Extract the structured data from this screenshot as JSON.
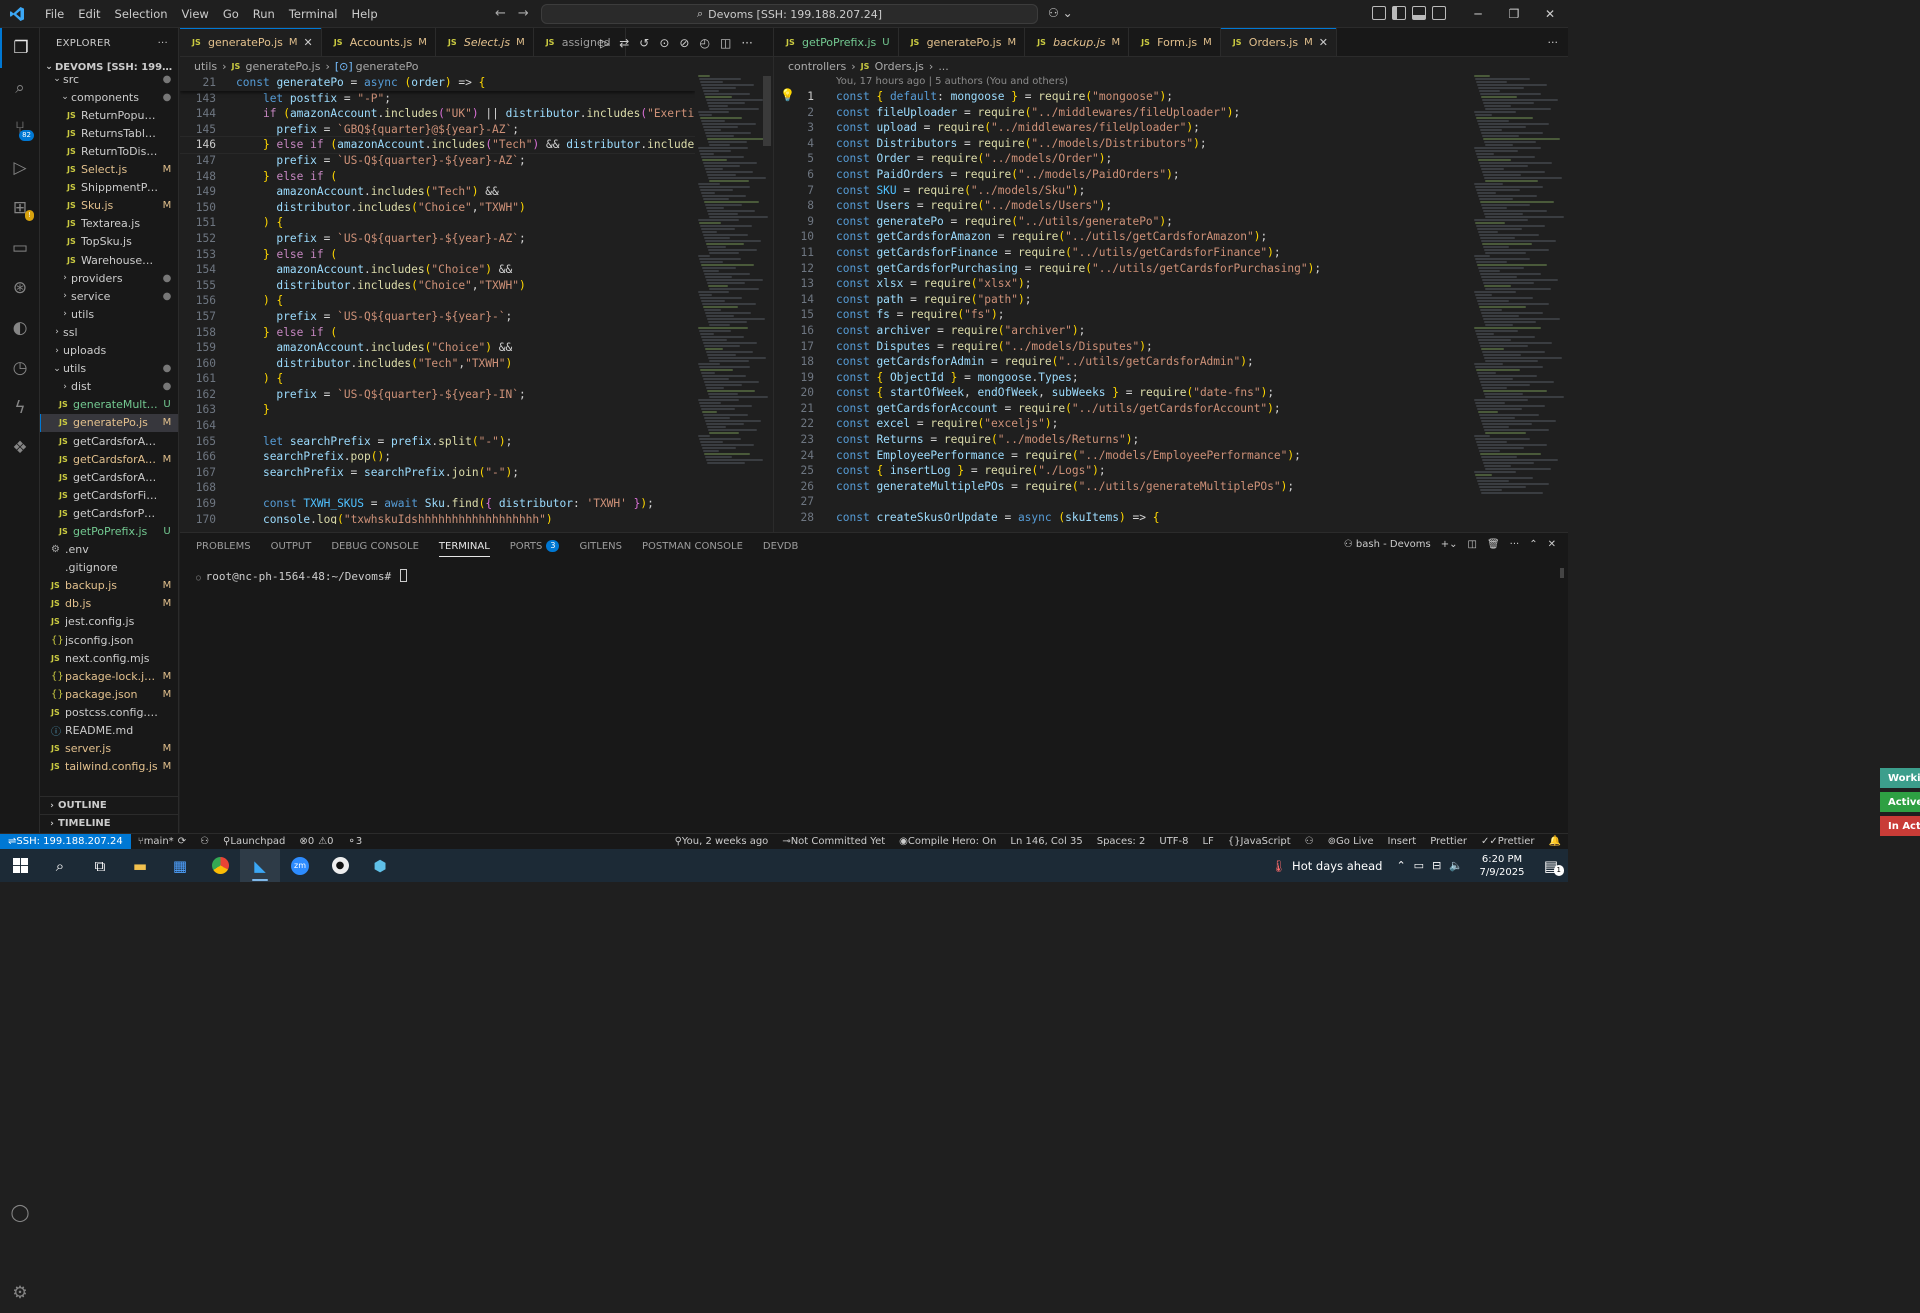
{
  "titlebar": {
    "menu": [
      "File",
      "Edit",
      "Selection",
      "View",
      "Go",
      "Run",
      "Terminal",
      "Help"
    ],
    "command_center": "Devoms [SSH: 199.188.207.24]"
  },
  "explorer": {
    "title": "EXPLORER",
    "root": "DEVOMS [SSH: 199.188.20...",
    "items": [
      {
        "label": "src",
        "type": "folder-open",
        "indent": 1,
        "status": "dot"
      },
      {
        "label": "components",
        "type": "folder-open",
        "indent": 2,
        "status": "dot"
      },
      {
        "label": "ReturnPopup.js",
        "type": "js",
        "indent": 3,
        "status": ""
      },
      {
        "label": "ReturnsTable.js",
        "type": "js",
        "indent": 3,
        "status": ""
      },
      {
        "label": "ReturnToDisti.js",
        "type": "js",
        "indent": 3,
        "status": ""
      },
      {
        "label": "Select.js",
        "type": "js",
        "indent": 3,
        "status": "M"
      },
      {
        "label": "ShippmentPending...",
        "type": "js",
        "indent": 3,
        "status": ""
      },
      {
        "label": "Sku.js",
        "type": "js",
        "indent": 3,
        "status": "M"
      },
      {
        "label": "Textarea.js",
        "type": "js",
        "indent": 3,
        "status": ""
      },
      {
        "label": "TopSku.js",
        "type": "js",
        "indent": 3,
        "status": ""
      },
      {
        "label": "WarehouseReturn.js",
        "type": "js",
        "indent": 3,
        "status": ""
      },
      {
        "label": "providers",
        "type": "folder",
        "indent": 2,
        "status": "dot"
      },
      {
        "label": "service",
        "type": "folder",
        "indent": 2,
        "status": "dot"
      },
      {
        "label": "utils",
        "type": "folder",
        "indent": 2,
        "status": ""
      },
      {
        "label": "ssl",
        "type": "folder",
        "indent": 1,
        "status": ""
      },
      {
        "label": "uploads",
        "type": "folder",
        "indent": 1,
        "status": ""
      },
      {
        "label": "utils",
        "type": "folder-open",
        "indent": 1,
        "status": "dot"
      },
      {
        "label": "dist",
        "type": "folder",
        "indent": 2,
        "status": "dot"
      },
      {
        "label": "generateMulti...",
        "type": "js",
        "indent": 2,
        "status": "U"
      },
      {
        "label": "generatePo.js",
        "type": "js",
        "indent": 2,
        "status": "M",
        "selected": true
      },
      {
        "label": "getCardsforAccount.js",
        "type": "js",
        "indent": 2,
        "status": ""
      },
      {
        "label": "getCardsforAd...",
        "type": "js",
        "indent": 2,
        "status": "M"
      },
      {
        "label": "getCardsforAmazon.js",
        "type": "js",
        "indent": 2,
        "status": ""
      },
      {
        "label": "getCardsforFinance.js",
        "type": "js",
        "indent": 2,
        "status": ""
      },
      {
        "label": "getCardsforPurchasi...",
        "type": "js",
        "indent": 2,
        "status": ""
      },
      {
        "label": "getPoPrefix.js",
        "type": "js",
        "indent": 2,
        "status": "U"
      },
      {
        "label": ".env",
        "type": "gear",
        "indent": 1,
        "status": ""
      },
      {
        "label": ".gitignore",
        "type": "plain",
        "indent": 1,
        "status": ""
      },
      {
        "label": "backup.js",
        "type": "js",
        "indent": 1,
        "status": "M"
      },
      {
        "label": "db.js",
        "type": "js",
        "indent": 1,
        "status": "M"
      },
      {
        "label": "jest.config.js",
        "type": "js",
        "indent": 1,
        "status": ""
      },
      {
        "label": "jsconfig.json",
        "type": "json",
        "indent": 1,
        "status": ""
      },
      {
        "label": "next.config.mjs",
        "type": "js",
        "indent": 1,
        "status": ""
      },
      {
        "label": "package-lock.json",
        "type": "json",
        "indent": 1,
        "status": "M"
      },
      {
        "label": "package.json",
        "type": "json",
        "indent": 1,
        "status": "M"
      },
      {
        "label": "postcss.config.mjs",
        "type": "js",
        "indent": 1,
        "status": ""
      },
      {
        "label": "README.md",
        "type": "info",
        "indent": 1,
        "status": ""
      },
      {
        "label": "server.js",
        "type": "js",
        "indent": 1,
        "status": "M"
      },
      {
        "label": "tailwind.config.js",
        "type": "js",
        "indent": 1,
        "status": "M"
      }
    ],
    "outline": "OUTLINE",
    "timeline": "TIMELINE"
  },
  "left_editor": {
    "tabs": [
      {
        "label": "generatePo.js",
        "status": "M",
        "active": true,
        "closable": true
      },
      {
        "label": "Accounts.js",
        "status": "M"
      },
      {
        "label": "Select.js",
        "status": "M",
        "italic": true
      },
      {
        "label": "assigned",
        "status": ""
      }
    ],
    "breadcrumbs": [
      "utils",
      "generatePo.js",
      "generatePo"
    ],
    "sticky_line": {
      "num": "21",
      "code": "const generatePo = async (order) => {"
    },
    "lines": [
      {
        "num": "143",
        "code": "    let postfix = \"-P\";"
      },
      {
        "num": "144",
        "code": "    if (amazonAccount.includes(\"UK\") || distributor.includes(\"Exertis\")) {"
      },
      {
        "num": "145",
        "code": "      prefix = `GBQ${quarter}@${year}-AZ`;"
      },
      {
        "num": "146",
        "code": "    } else if (amazonAccount.includes(\"Tech\") && distributor.includes(\"Tec"
      },
      {
        "num": "147",
        "code": "      prefix = `US-Q${quarter}-${year}-AZ`;"
      },
      {
        "num": "148",
        "code": "    } else if ("
      },
      {
        "num": "149",
        "code": "      amazonAccount.includes(\"Tech\") &&"
      },
      {
        "num": "150",
        "code": "      distributor.includes(\"Choice\",\"TXWH\")"
      },
      {
        "num": "151",
        "code": "    ) {"
      },
      {
        "num": "152",
        "code": "      prefix = `US-Q${quarter}-${year}-AZ`;"
      },
      {
        "num": "153",
        "code": "    } else if ("
      },
      {
        "num": "154",
        "code": "      amazonAccount.includes(\"Choice\") &&"
      },
      {
        "num": "155",
        "code": "      distributor.includes(\"Choice\",\"TXWH\")"
      },
      {
        "num": "156",
        "code": "    ) {"
      },
      {
        "num": "157",
        "code": "      prefix = `US-Q${quarter}-${year}-`;"
      },
      {
        "num": "158",
        "code": "    } else if ("
      },
      {
        "num": "159",
        "code": "      amazonAccount.includes(\"Choice\") &&"
      },
      {
        "num": "160",
        "code": "      distributor.includes(\"Tech\",\"TXWH\")"
      },
      {
        "num": "161",
        "code": "    ) {"
      },
      {
        "num": "162",
        "code": "      prefix = `US-Q${quarter}-${year}-IN`;"
      },
      {
        "num": "163",
        "code": "    }"
      },
      {
        "num": "164",
        "code": ""
      },
      {
        "num": "165",
        "code": "    let searchPrefix = prefix.split(\"-\");"
      },
      {
        "num": "166",
        "code": "    searchPrefix.pop();"
      },
      {
        "num": "167",
        "code": "    searchPrefix = searchPrefix.join(\"-\");"
      },
      {
        "num": "168",
        "code": ""
      },
      {
        "num": "169",
        "code": "    const TXWH_SKUS = await Sku.find({ distributor: 'TXWH' });"
      },
      {
        "num": "170",
        "code": "    console.log(\"txwhskuIdshhhhhhhhhhhhhhhhhh\")"
      }
    ],
    "current_line": "146"
  },
  "right_editor": {
    "tabs": [
      {
        "label": "getPoPrefix.js",
        "status": "U"
      },
      {
        "label": "generatePo.js",
        "status": "M"
      },
      {
        "label": "backup.js",
        "status": "M",
        "italic": true
      },
      {
        "label": "Form.js",
        "status": "M"
      },
      {
        "label": "Orders.js",
        "status": "M",
        "active": true,
        "closable": true
      }
    ],
    "breadcrumbs": [
      "controllers",
      "Orders.js",
      "..."
    ],
    "blame": "You, 17 hours ago | 5 authors (You and others)",
    "lines": [
      {
        "num": "1",
        "code": "const { default: mongoose } = require(\"mongoose\");"
      },
      {
        "num": "2",
        "code": "const fileUploader = require(\"../middlewares/fileUploader\");"
      },
      {
        "num": "3",
        "code": "const upload = require(\"../middlewares/fileUploader\");"
      },
      {
        "num": "4",
        "code": "const Distributors = require(\"../models/Distributors\");"
      },
      {
        "num": "5",
        "code": "const Order = require(\"../models/Order\");"
      },
      {
        "num": "6",
        "code": "const PaidOrders = require(\"../models/PaidOrders\");"
      },
      {
        "num": "7",
        "code": "const SKU = require(\"../models/Sku\");"
      },
      {
        "num": "8",
        "code": "const Users = require(\"../models/Users\");"
      },
      {
        "num": "9",
        "code": "const generatePo = require(\"../utils/generatePo\");"
      },
      {
        "num": "10",
        "code": "const getCardsforAmazon = require(\"../utils/getCardsforAmazon\");"
      },
      {
        "num": "11",
        "code": "const getCardsforFinance = require(\"../utils/getCardsforFinance\");"
      },
      {
        "num": "12",
        "code": "const getCardsforPurchasing = require(\"../utils/getCardsforPurchasing\");"
      },
      {
        "num": "13",
        "code": "const xlsx = require(\"xlsx\");"
      },
      {
        "num": "14",
        "code": "const path = require(\"path\");"
      },
      {
        "num": "15",
        "code": "const fs = require(\"fs\");"
      },
      {
        "num": "16",
        "code": "const archiver = require(\"archiver\");"
      },
      {
        "num": "17",
        "code": "const Disputes = require(\"../models/Disputes\");"
      },
      {
        "num": "18",
        "code": "const getCardsforAdmin = require(\"../utils/getCardsforAdmin\");"
      },
      {
        "num": "19",
        "code": "const { ObjectId } = mongoose.Types;"
      },
      {
        "num": "20",
        "code": "const { startOfWeek, endOfWeek, subWeeks } = require(\"date-fns\");"
      },
      {
        "num": "21",
        "code": "const getCardsforAccount = require(\"../utils/getCardsforAccount\");"
      },
      {
        "num": "22",
        "code": "const excel = require(\"exceljs\");"
      },
      {
        "num": "23",
        "code": "const Returns = require(\"../models/Returns\");"
      },
      {
        "num": "24",
        "code": "const EmployeePerformance = require(\"../models/EmployeePerformance\");"
      },
      {
        "num": "25",
        "code": "const { insertLog } = require(\"./Logs\");"
      },
      {
        "num": "26",
        "code": "const generateMultiplePOs = require(\"../utils/generateMultiplePOs\");"
      },
      {
        "num": "27",
        "code": ""
      },
      {
        "num": "28",
        "code": "const createSkusOrUpdate = async (skuItems) => {"
      }
    ]
  },
  "panel": {
    "tabs": [
      "PROBLEMS",
      "OUTPUT",
      "DEBUG CONSOLE",
      "TERMINAL",
      "PORTS",
      "GITLENS",
      "POSTMAN CONSOLE",
      "DEVDB"
    ],
    "ports_count": "3",
    "active_tab": "TERMINAL",
    "terminal_name": "bash - Devoms",
    "prompt": "root@nc-ph-1564-48:~/Devoms# "
  },
  "notifications": [
    "Workin",
    "Active",
    "In Acti"
  ],
  "statusbar": {
    "remote": "SSH: 199.188.207.24",
    "branch": "main*",
    "launchpad": "Launchpad",
    "errors": "0",
    "warnings": "0",
    "ports": "3",
    "blame": "You, 2 weeks ago",
    "commit": "Not Committed Yet",
    "compile_hero": "Compile Hero: On",
    "position": "Ln 146, Col 35",
    "spaces": "Spaces: 2",
    "encoding": "UTF-8",
    "eol": "LF",
    "language": "JavaScript",
    "golive": "Go Live",
    "insert": "Insert",
    "prettier1": "Prettier",
    "prettier2": "Prettier"
  },
  "taskbar": {
    "weather": "Hot days ahead",
    "time": "6:20 PM",
    "date": "7/9/2025",
    "notification_count": "1"
  },
  "colors": {
    "accent": "#0078d4",
    "modified": "#e2c08d",
    "untracked": "#73c991"
  }
}
